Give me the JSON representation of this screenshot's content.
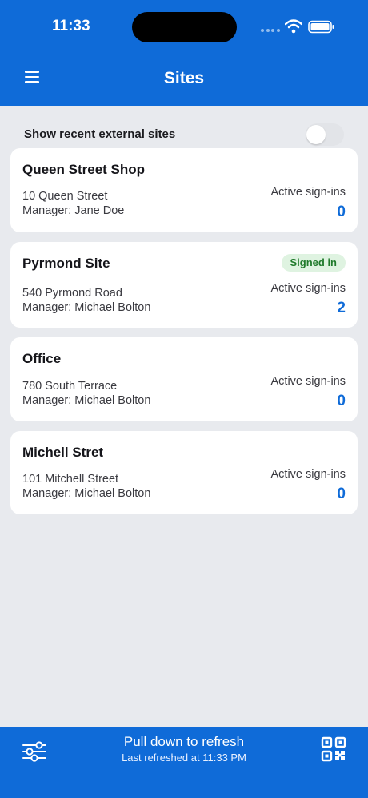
{
  "status_bar": {
    "time": "11:33"
  },
  "header": {
    "title": "Sites"
  },
  "toggle": {
    "label": "Show recent external sites",
    "on": false
  },
  "sites": [
    {
      "name": "Queen Street Shop",
      "address": "10 Queen Street",
      "manager": "Manager: Jane Doe",
      "active_label": "Active sign-ins",
      "active_count": "0",
      "badge": ""
    },
    {
      "name": "Pyrmond Site",
      "address": "540 Pyrmond Road",
      "manager": "Manager: Michael Bolton",
      "active_label": "Active sign-ins",
      "active_count": "2",
      "badge": "Signed in"
    },
    {
      "name": "Office",
      "address": "780 South Terrace",
      "manager": "Manager: Michael Bolton",
      "active_label": "Active sign-ins",
      "active_count": "0",
      "badge": ""
    },
    {
      "name": "Michell Stret",
      "address": "101 Mitchell Street",
      "manager": "Manager: Michael Bolton",
      "active_label": "Active sign-ins",
      "active_count": "0",
      "badge": ""
    }
  ],
  "footer": {
    "title": "Pull down to refresh",
    "subtitle": "Last refreshed at 11:33 PM"
  },
  "icons": {
    "menu": "menu-icon",
    "filter": "filter-sliders-icon",
    "qr": "qr-code-icon",
    "wifi": "wifi-icon",
    "battery": "battery-icon"
  },
  "colors": {
    "primary": "#0f6bd8",
    "background": "#e8eaee",
    "badge_bg": "#dff3e1",
    "badge_text": "#1f7a2b"
  }
}
